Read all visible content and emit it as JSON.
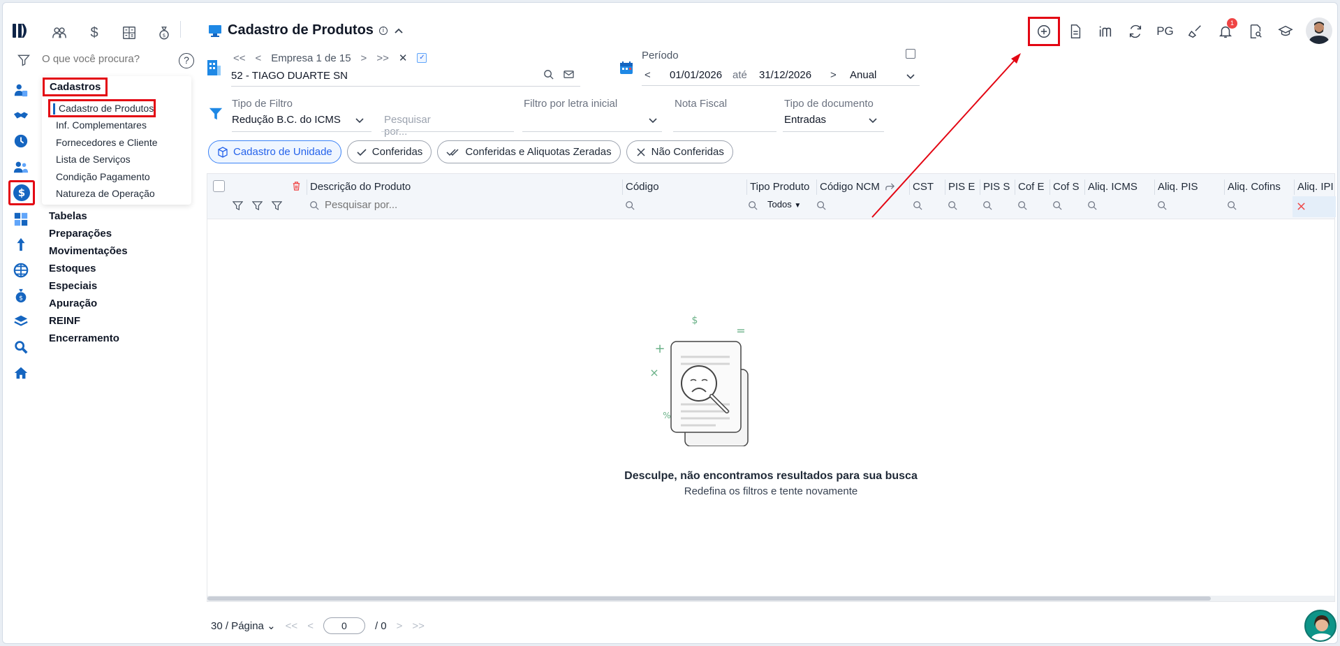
{
  "header": {
    "title": "Cadastro de Produtos",
    "toolbar": [
      {
        "icon": "add-circle-icon"
      },
      {
        "icon": "document-icon"
      },
      {
        "icon": "im-logo-icon"
      },
      {
        "icon": "refresh-icon"
      },
      {
        "label": "PG"
      },
      {
        "icon": "broom-icon"
      },
      {
        "icon": "bell-icon",
        "badge": "1"
      },
      {
        "icon": "report-search-icon"
      },
      {
        "icon": "graduation-cap-icon"
      }
    ]
  },
  "top_icons": [
    "users-icon",
    "dollar-icon",
    "calculator-icon",
    "money-bag-icon"
  ],
  "search": {
    "placeholder": "O que você procura?",
    "help": "?"
  },
  "menu": {
    "group_title": "Cadastros",
    "subitems": [
      "Cadastro de Produtos",
      "Inf. Complementares",
      "Fornecedores e Cliente",
      "Lista de Serviços",
      "Condição Pagamento",
      "Natureza de Operação"
    ],
    "items": [
      "Tabelas",
      "Preparações",
      "Movimentações",
      "Estoques",
      "Especiais",
      "Apuração",
      "REINF",
      "Encerramento"
    ]
  },
  "empresa": {
    "nav_label": "Empresa 1 de 15",
    "value": "52 - TIAGO DUARTE SN"
  },
  "periodo": {
    "label": "Período",
    "start": "01/01/2026",
    "sep": "até",
    "end": "31/12/2026",
    "mode": "Anual"
  },
  "filters": {
    "tipo_filtro": {
      "label": "Tipo de Filtro",
      "value": "Redução B.C. do ICMS"
    },
    "pesquisar": {
      "placeholder": "Pesquisar por..."
    },
    "letra": {
      "label": "Filtro por letra inicial",
      "value": ""
    },
    "nota": {
      "label": "Nota Fiscal",
      "value": ""
    },
    "tipo_doc": {
      "label": "Tipo de documento",
      "value": "Entradas"
    }
  },
  "chips": [
    "Cadastro de Unidade",
    "Conferidas",
    "Conferidas e Aliquotas Zeradas",
    "Não Conferidas"
  ],
  "table": {
    "columns": [
      "Descrição do Produto",
      "Código",
      "Tipo Produto",
      "Código NCM",
      "CST",
      "PIS E",
      "PIS S",
      "Cof E",
      "Cof S",
      "Aliq. ICMS",
      "Aliq. PIS",
      "Aliq. Cofins",
      "Aliq. IPI"
    ],
    "search_placeholder": "Pesquisar por...",
    "tipo_select": "Todos",
    "empty_title": "Desculpe, não encontramos resultados para sua busca",
    "empty_sub": "Redefina os filtros e tente novamente"
  },
  "pager": {
    "per_page": "30 / Página",
    "current": "0",
    "total": "/ 0"
  },
  "colors": {
    "accent": "#1565c0",
    "highlight": "#e30613",
    "chip_active": "#3b82f6"
  }
}
